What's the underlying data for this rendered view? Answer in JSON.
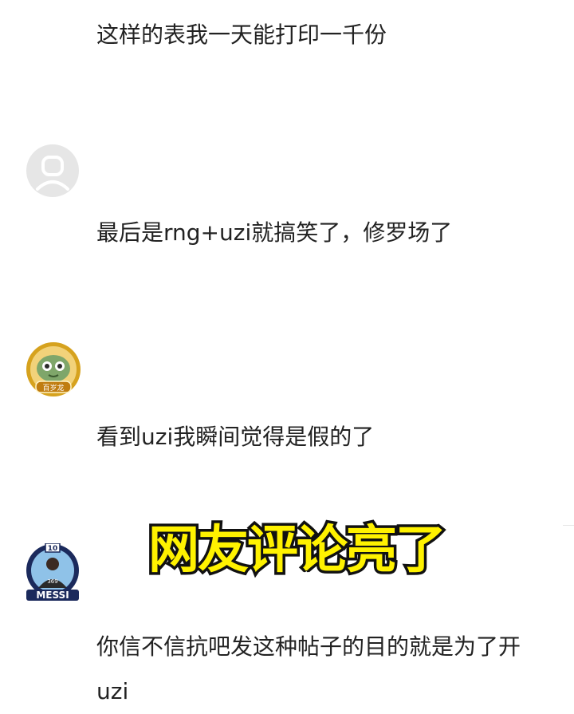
{
  "comments": [
    {
      "text": "这样的表我一天能打印一千份"
    },
    {
      "text": "最后是rng+uzi就搞笑了，修罗场了"
    },
    {
      "text": "看到uzi我瞬间觉得是假的了",
      "avatar_badge": "百岁龙"
    },
    {
      "text": "你信不信抗吧发这种帖子的目的就是为了开uzi",
      "avatar_badge": "MESSI",
      "avatar_number": "10",
      "jersey_number": "369"
    }
  ],
  "overlay_caption": "网友评论亮了",
  "icons": {
    "default_avatar": "user-silhouette-icon",
    "frog_avatar": "frog-badge-icon",
    "messi_avatar": "messi-badge-icon"
  },
  "colors": {
    "caption_fill": "#fff200",
    "caption_stroke": "#111111",
    "text": "#222222",
    "default_avatar_bg": "#e6e6e6",
    "badge_gold": "#d6a21e"
  }
}
